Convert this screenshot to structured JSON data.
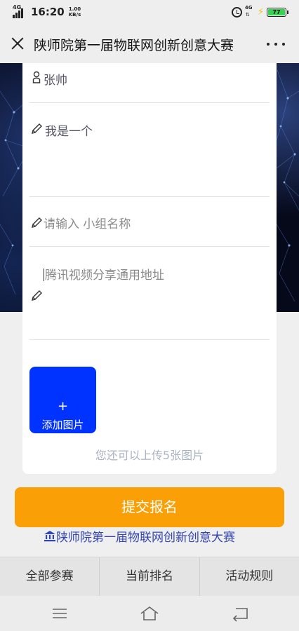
{
  "status_bar": {
    "network_tag": "4G",
    "time": "16:20",
    "speed_value": "1.00",
    "speed_unit": "KB/s",
    "network_tag_right": "4G",
    "battery_level": "77",
    "icons": [
      "signal-icon",
      "alarm-icon",
      "charging-icon",
      "battery-icon"
    ]
  },
  "title_bar": {
    "title": "陕师院第一届物联网创新创意大赛",
    "close_icon": "close-icon",
    "more_icon": "more-icon"
  },
  "form": {
    "name_value": "张帅",
    "intro_value": "我是一个",
    "group_placeholder": "请输入 小组名称",
    "video_placeholder": "腾讯视频分享通用地址",
    "icons": [
      "person-icon",
      "pencil-icon"
    ]
  },
  "upload": {
    "plus": "+",
    "label": "添加图片",
    "hint": "您还可以上传5张图片"
  },
  "submit": {
    "label": "提交报名",
    "color": "#fa9f05"
  },
  "event_link": {
    "label": "陕师院第一届物联网创新创意大赛",
    "icon": "bank-icon",
    "color": "#3346b0"
  },
  "bottom_tabs": [
    "全部参赛",
    "当前排名",
    "活动规则"
  ],
  "system_nav": [
    "menu-icon",
    "home-icon",
    "back-icon"
  ],
  "colors": {
    "upload_button": "#0033ff",
    "banner": "#06091a"
  }
}
